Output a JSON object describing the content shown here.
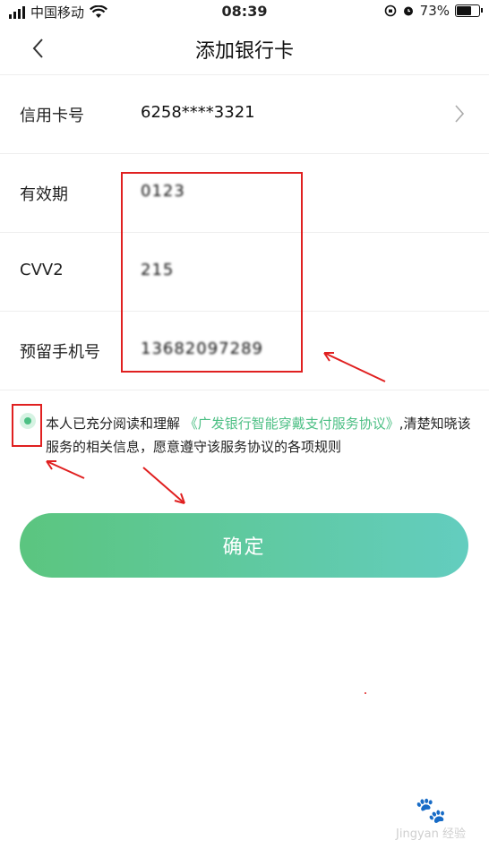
{
  "status_bar": {
    "carrier": "中国移动",
    "time": "08:39",
    "battery_percent": "73%",
    "icons": [
      "signal-icon",
      "wifi-icon",
      "orientation-lock-icon",
      "alarm-icon",
      "battery-icon"
    ]
  },
  "header": {
    "title": "添加银行卡",
    "back_icon": "chevron-left-icon"
  },
  "form": {
    "rows": [
      {
        "label": "信用卡号",
        "value": "6258****3321"
      },
      {
        "label": "有效期",
        "value": "0123"
      },
      {
        "label": "CVV2",
        "value": "215"
      },
      {
        "label": "预留手机号",
        "value": "13682097289"
      }
    ]
  },
  "agreement": {
    "checked": true,
    "text_before": "本人已充分阅读和理解 ",
    "link": "《广发银行智能穿戴支付服务协议》",
    "text_after": ",清楚知晓该服务的相关信息，愿意遵守该服务协议的各项规则"
  },
  "confirm_button": {
    "label": "确定"
  },
  "colors": {
    "accent_green": "#4cbf84",
    "button_gradient_start": "#5bc57f",
    "button_gradient_end": "#63cdbf",
    "annotation_red": "#e02020"
  },
  "watermark": {
    "text": "Jingyan 经验"
  }
}
